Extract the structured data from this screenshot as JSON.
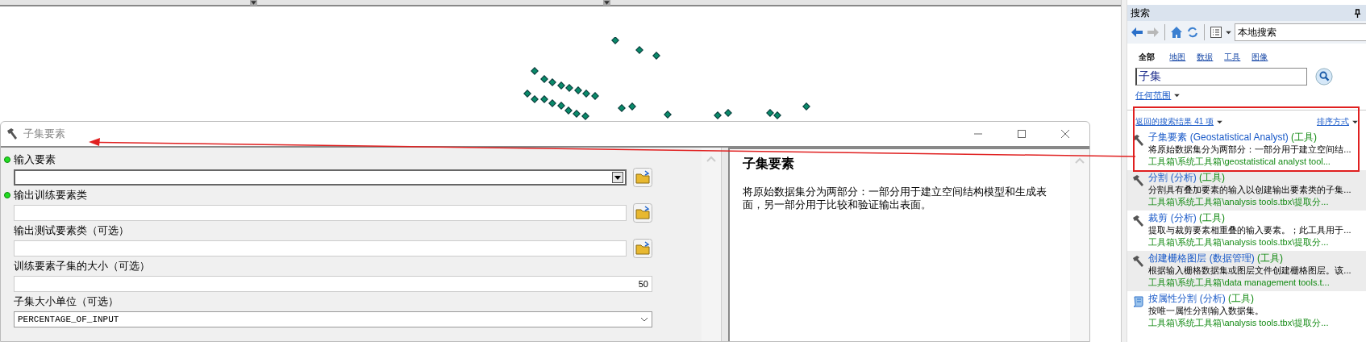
{
  "dialog": {
    "title": "子集要素",
    "params": [
      {
        "label": "输入要素",
        "required": true,
        "kind": "dropdown"
      },
      {
        "label": "输出训练要素类",
        "required": true,
        "kind": "output"
      },
      {
        "label": "输出测试要素类（可选）",
        "required": false,
        "kind": "output"
      },
      {
        "label": "训练要素子集的大小（可选）",
        "required": false,
        "kind": "number",
        "value": "50"
      },
      {
        "label": "子集大小单位（可选）",
        "required": false,
        "kind": "select",
        "value": "PERCENTAGE_OF_INPUT"
      }
    ],
    "help": {
      "title": "子集要素",
      "text": "将原始数据集分为两部分：一部分用于建立空间结构模型和生成表面，另一部分用于比较和验证输出表面。"
    }
  },
  "search_panel": {
    "title": "搜索",
    "scope_field": "本地搜索",
    "tabs": [
      {
        "label": "全部",
        "selected": true
      },
      {
        "label": "地图",
        "selected": false
      },
      {
        "label": "数据",
        "selected": false
      },
      {
        "label": "工具",
        "selected": false
      },
      {
        "label": "图像",
        "selected": false
      }
    ],
    "query": "子集",
    "range": "任何范围",
    "results_summary": "返回的搜索结果 41 项",
    "sort": "排序方式",
    "results": [
      {
        "kind": "tool",
        "title": "子集要素 (Geostatistical Analyst)",
        "type": "(工具)",
        "description": "将原始数据集分为两部分：一部分用于建立空间结...",
        "path": "工具箱\\系统工具箱\\geostatistical analyst tool..."
      },
      {
        "kind": "tool",
        "title": "分割 (分析)",
        "type": "(工具)",
        "description": "分割具有叠加要素的输入以创建输出要素类的子集...",
        "path": "工具箱\\系统工具箱\\analysis tools.tbx\\提取分..."
      },
      {
        "kind": "tool",
        "title": "裁剪 (分析)",
        "type": "(工具)",
        "description": "提取与裁剪要素相重叠的输入要素。；此工具用于...",
        "path": "工具箱\\系统工具箱\\analysis tools.tbx\\提取分..."
      },
      {
        "kind": "tool",
        "title": "创建栅格图层 (数据管理)",
        "type": "(工具)",
        "description": "根据输入栅格数据集或图层文件创建栅格图层。该...",
        "path": "工具箱\\系统工具箱\\data management tools.t..."
      },
      {
        "kind": "script",
        "title": "按属性分割 (分析)",
        "type": "(工具)",
        "description": "按唯一属性分割输入数据集。",
        "path": "工具箱\\系统工具箱\\analysis tools.tbx\\提取分..."
      }
    ]
  }
}
